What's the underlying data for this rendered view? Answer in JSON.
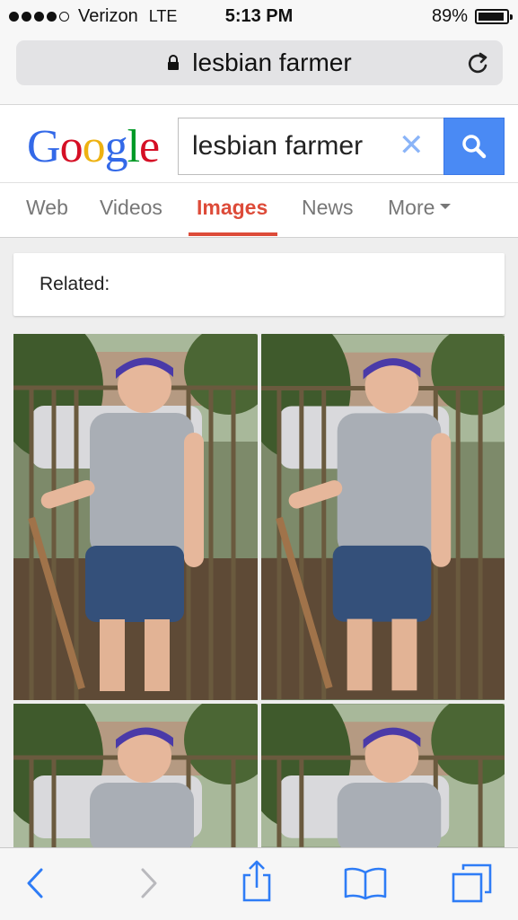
{
  "status_bar": {
    "carrier": "Verizon",
    "network": "LTE",
    "time": "5:13 PM",
    "battery": "89%"
  },
  "address_bar": {
    "url": "lesbian farmer"
  },
  "google": {
    "logo": "Google",
    "search_query": "lesbian farmer",
    "tabs": [
      {
        "label": "Web"
      },
      {
        "label": "Videos"
      },
      {
        "label": "Images"
      },
      {
        "label": "News"
      },
      {
        "label": "More"
      }
    ]
  },
  "related_label": "Related:",
  "colors": {
    "google_blue": "#4a8af4",
    "active_tab": "#dd4b39",
    "safari_blue": "#2e7cf6"
  }
}
